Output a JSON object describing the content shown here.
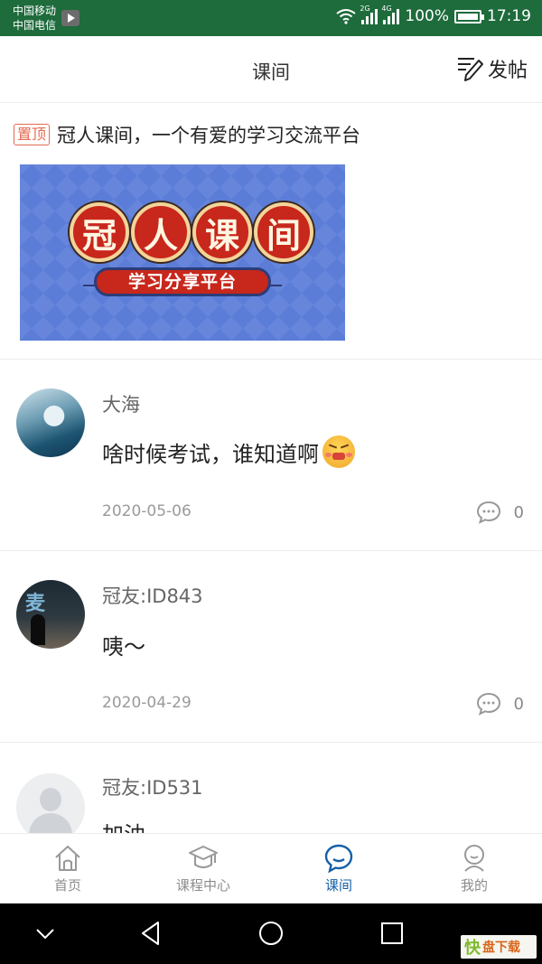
{
  "status_bar": {
    "carrier_1": "中国移动",
    "carrier_2": "中国电信",
    "net_1": "2G",
    "net_2": "4G",
    "battery": "100%",
    "time": "17:19"
  },
  "header": {
    "title": "课间",
    "post_label": "发帖"
  },
  "pinned": {
    "tag": "置顶",
    "title": "冠人课间，一个有爱的学习交流平台",
    "banner_chars": [
      "冠",
      "人",
      "课",
      "间"
    ],
    "banner_subtitle": "学习分享平台"
  },
  "posts": [
    {
      "username": "大海",
      "content": "啥时候考试，谁知道啊",
      "date": "2020-05-06",
      "comments": "0"
    },
    {
      "username": "冠友:ID843",
      "content": "咦～",
      "date": "2020-04-29",
      "comments": "0"
    },
    {
      "username": "冠友:ID531",
      "content": "加油"
    }
  ],
  "tabs": [
    {
      "label": "首页",
      "icon": "home-icon"
    },
    {
      "label": "课程中心",
      "icon": "graduation-cap-icon"
    },
    {
      "label": "课间",
      "icon": "chat-bubble-icon",
      "active": true
    },
    {
      "label": "我的",
      "icon": "user-icon"
    }
  ],
  "watermark": {
    "k": "快",
    "text": "盘下载"
  },
  "colors": {
    "status_bar": "#1e6b3c",
    "active_tab": "#1560a8",
    "pin_tag": "#e26a50"
  }
}
